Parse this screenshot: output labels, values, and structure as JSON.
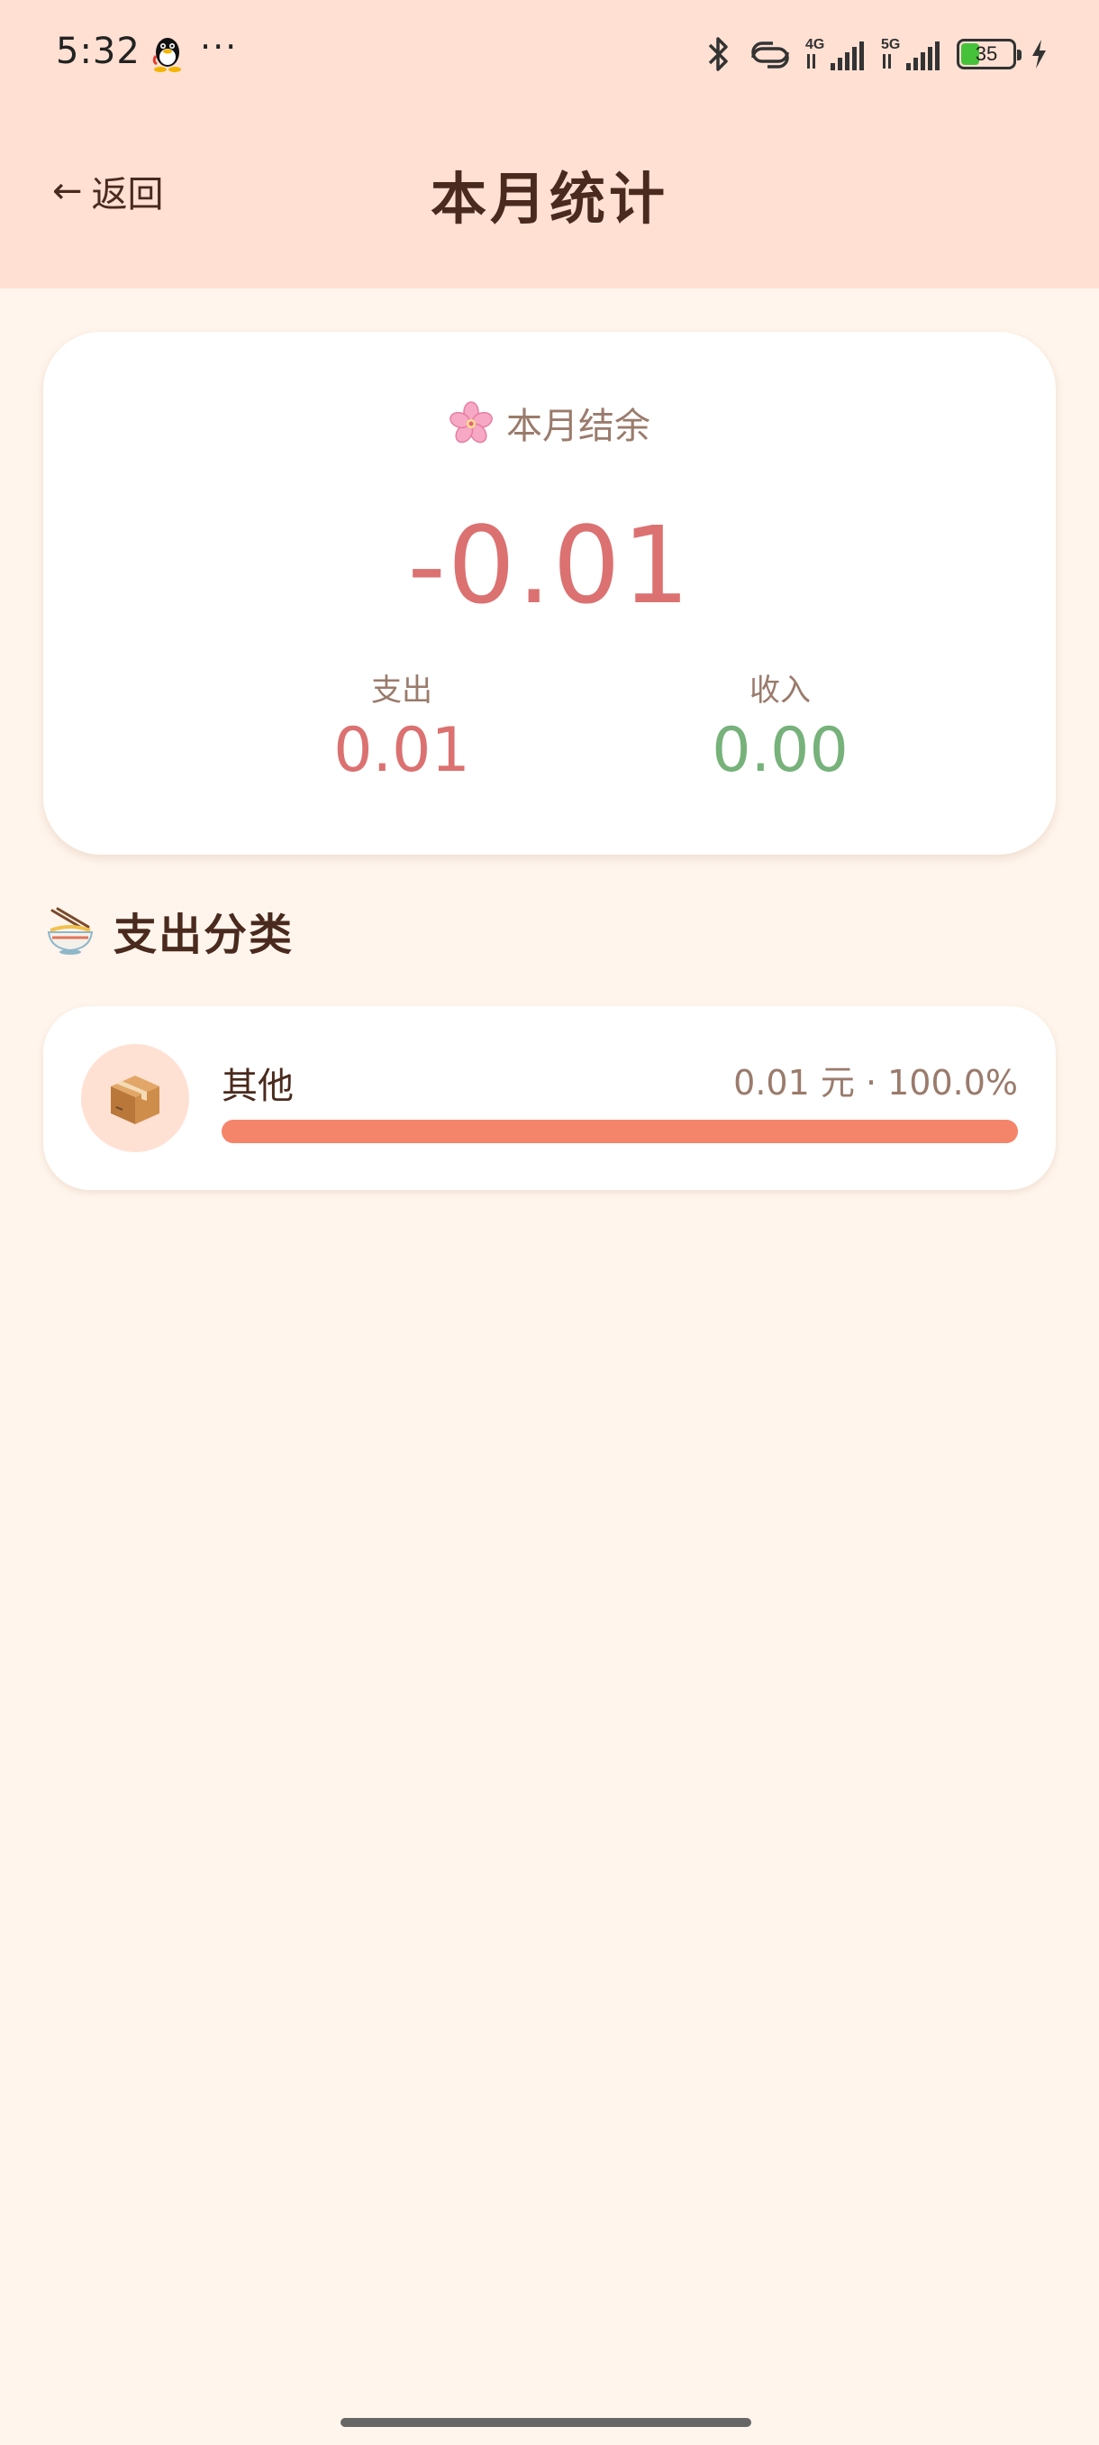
{
  "status_bar": {
    "time": "5:32",
    "more": "···",
    "network_4g": "4G",
    "network_5g": "5G",
    "battery": "35",
    "icons": [
      "qq-icon",
      "bluetooth-icon",
      "hotspot-icon",
      "signal-icon",
      "battery-icon",
      "charging-icon"
    ]
  },
  "header": {
    "back_arrow": "←",
    "back_label": "返回",
    "title": "本月统计"
  },
  "summary": {
    "label": "本月结余",
    "balance": "-0.01",
    "expense_label": "支出",
    "expense_value": "0.01",
    "income_label": "收入",
    "income_value": "0.00",
    "colors": {
      "expense": "#dc7171",
      "income": "#76b27a"
    }
  },
  "category_section": {
    "title": "支出分类",
    "items": [
      {
        "name": "其他",
        "amount": "0.01 元 · 100.0%",
        "share": 1.0,
        "icon": "package-icon"
      }
    ]
  },
  "colors": {
    "header_bg": "#ffe0d3",
    "page_bg": "#fff5ec",
    "bar": "#f5856a"
  }
}
